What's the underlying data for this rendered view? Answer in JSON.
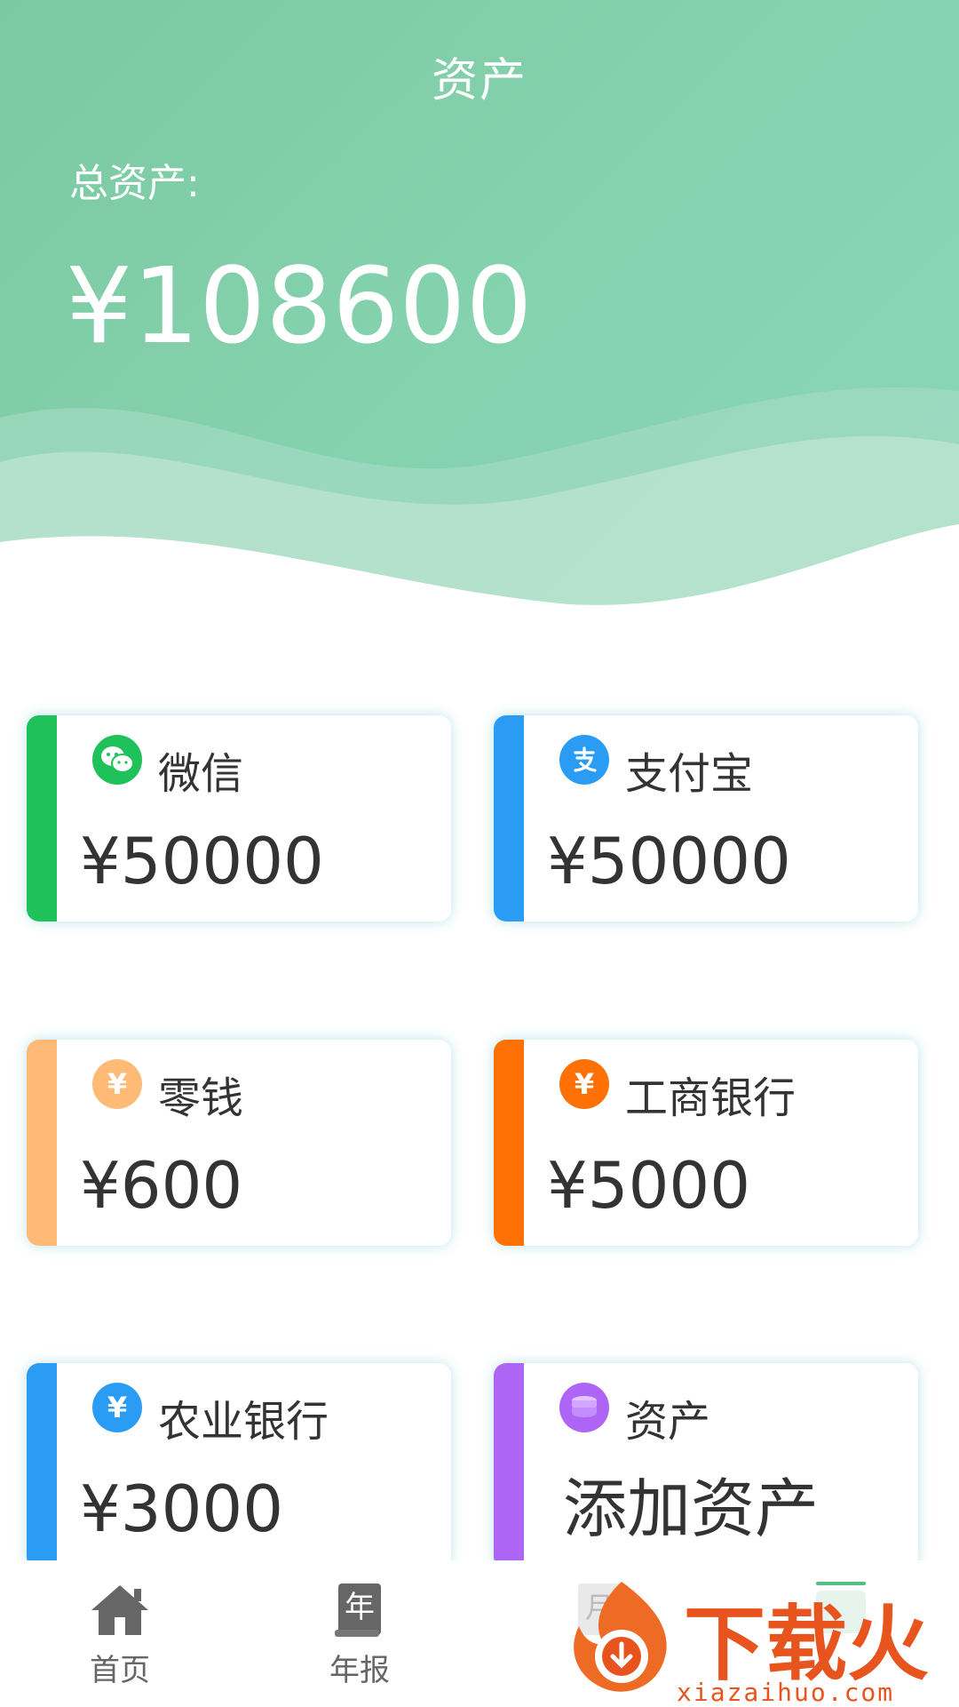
{
  "header": {
    "title": "资产",
    "total_label": "总资产:",
    "total_value": "¥108600"
  },
  "accounts": [
    {
      "name": "微信",
      "amount": "¥50000",
      "icon": "wechat-icon",
      "color": "#1ec15a"
    },
    {
      "name": "支付宝",
      "amount": "¥50000",
      "icon": "alipay-icon",
      "color": "#2b9cf4"
    },
    {
      "name": "零钱",
      "amount": "¥600",
      "icon": "yuan-icon",
      "color": "#ffbb76"
    },
    {
      "name": "工商银行",
      "amount": "¥5000",
      "icon": "yuan-icon",
      "color": "#ff7105"
    },
    {
      "name": "农业银行",
      "amount": "¥3000",
      "icon": "yuan-icon",
      "color": "#2b9cf4"
    },
    {
      "name": "资产",
      "action": "添加资产",
      "icon": "coins-icon",
      "color": "#ae64f4"
    }
  ],
  "tabbar": {
    "items": [
      {
        "label": "首页",
        "icon": "home-icon"
      },
      {
        "label": "年报",
        "icon": "annual-report-icon"
      },
      {
        "label": "月",
        "icon": "monthly-report-icon"
      },
      {
        "label": "",
        "icon": "assets-icon"
      }
    ]
  },
  "watermark": {
    "brand": "下载火",
    "site": "xiazaihuo.com"
  },
  "colors": {
    "header_green": "#84d1ad",
    "text_dark": "#333333"
  }
}
